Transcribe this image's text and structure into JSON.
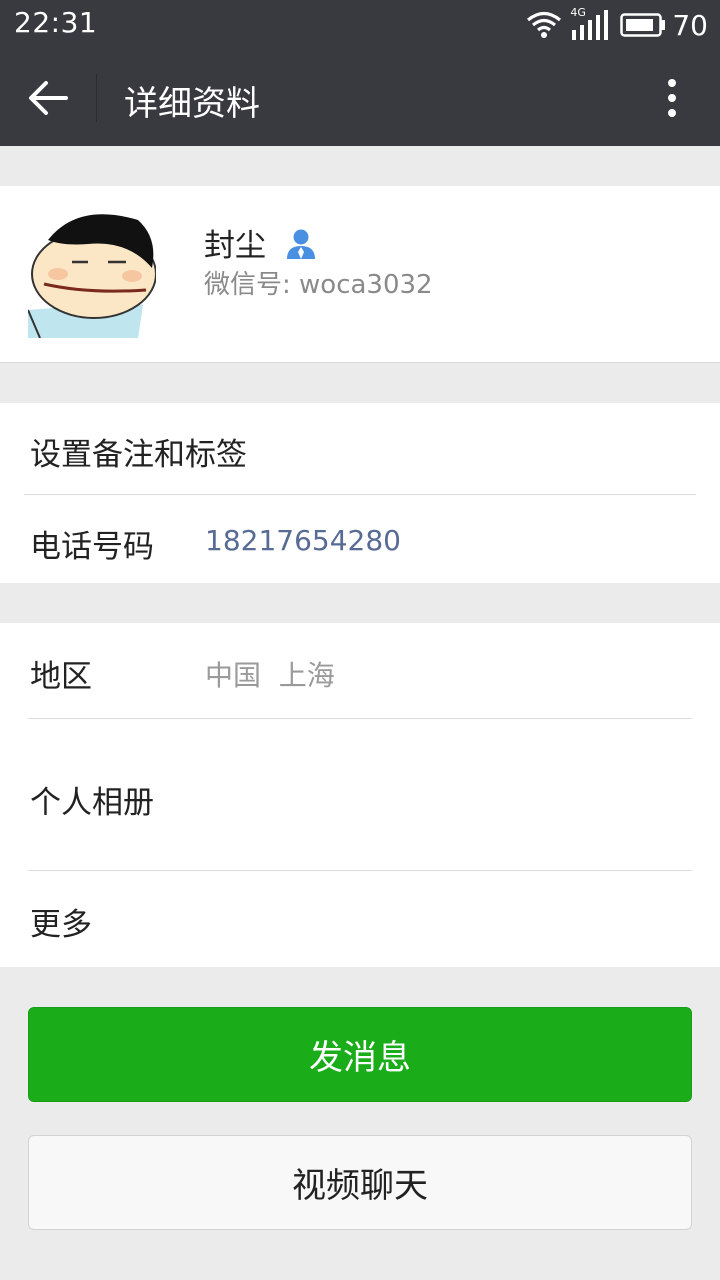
{
  "status": {
    "time": "22:31",
    "network": "4G",
    "battery": "70"
  },
  "header": {
    "title": "详细资料",
    "back_icon": "arrow-left-icon",
    "more_icon": "more-vertical-icon"
  },
  "profile": {
    "name": "封尘",
    "wechat_id": "微信号: woca3032",
    "gender_icon": "user-male-icon"
  },
  "rows": {
    "remark": {
      "label": "设置备注和标签"
    },
    "phone": {
      "label": "电话号码",
      "value": "18217654280"
    },
    "region": {
      "label": "地区",
      "value": "中国  上海"
    },
    "album": {
      "label": "个人相册"
    },
    "more": {
      "label": "更多"
    }
  },
  "buttons": {
    "send_message": "发消息",
    "video_chat": "视频聊天"
  },
  "colors": {
    "topbar": "#393a3f",
    "primary_green": "#1aad19",
    "link_blue": "#576b95",
    "bg": "#ebebeb"
  }
}
